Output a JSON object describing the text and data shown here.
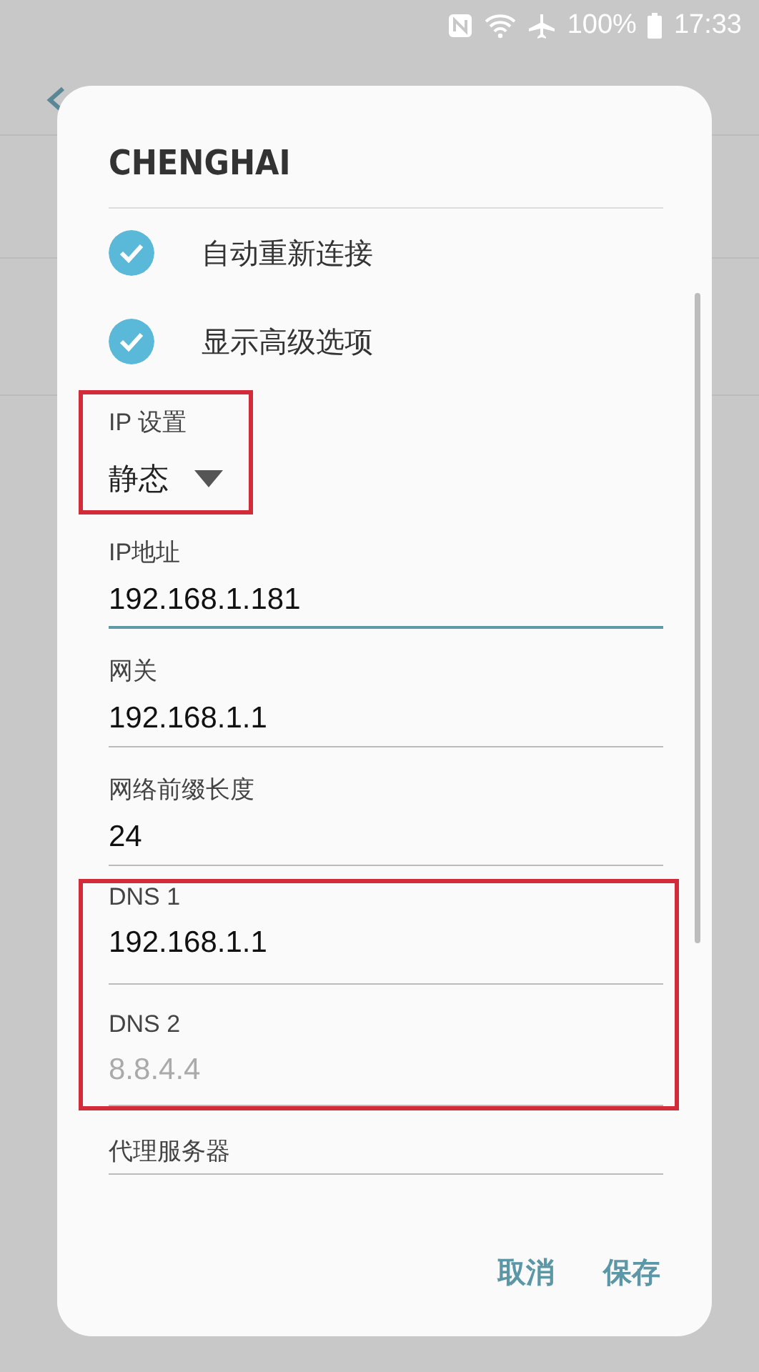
{
  "status_bar": {
    "battery": "100%",
    "time": "17:33"
  },
  "dialog": {
    "title": "CHENGHAI",
    "options": [
      {
        "label": "自动重新连接",
        "checked": true
      },
      {
        "label": "显示高级选项",
        "checked": true
      }
    ],
    "ip_settings": {
      "label": "IP 设置",
      "value": "静态",
      "highlighted": true
    },
    "fields": [
      {
        "label": "IP地址",
        "value": "192.168.1.181",
        "focused": true
      },
      {
        "label": "网关",
        "value": "192.168.1.1",
        "focused": false
      },
      {
        "label": "网络前缀长度",
        "value": "24",
        "focused": false
      }
    ],
    "dns": {
      "highlighted": true,
      "fields": [
        {
          "label": "DNS 1",
          "value": "192.168.1.1"
        },
        {
          "label": "DNS 2",
          "placeholder": "8.8.4.4"
        }
      ]
    },
    "proxy": {
      "label": "代理服务器"
    },
    "buttons": [
      "取消",
      "保存"
    ]
  }
}
